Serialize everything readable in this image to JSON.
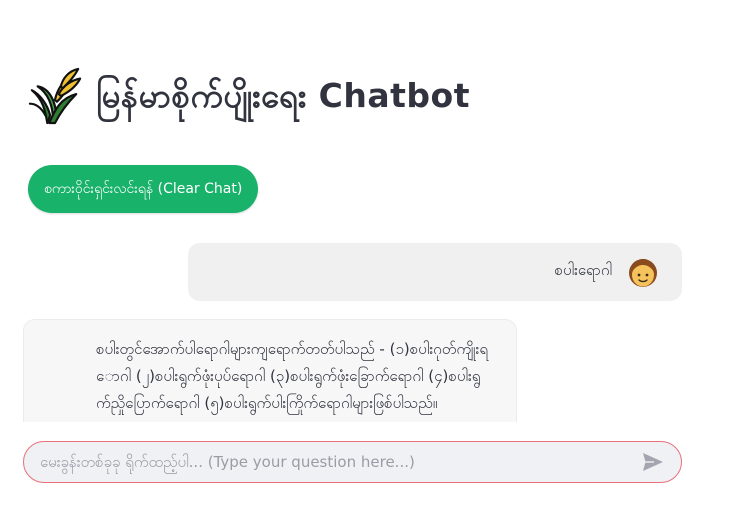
{
  "header": {
    "title": "မြန်မာစိုက်ပျိုးရေး Chatbot",
    "logo_icon": "rice-plant-icon"
  },
  "toolbar": {
    "clear_label": "စကားဝိုင်းရှင်းလင်းရန် (Clear Chat)"
  },
  "chat": {
    "messages": [
      {
        "role": "user",
        "text": "စပါးရောဂါ",
        "avatar_icon": "user-avatar-icon"
      },
      {
        "role": "assistant",
        "text": "စပါးတွင်အောက်ပါရောဂါများကျရောက်တတ်ပါသည် - (၁)စပါးဂုတ်ကျိုးရောဂါ (၂)စပါးရွက်ဖုံးပုပ်ရောဂါ (၃)စပါးရွက်ဖုံးခြောက်ရောဂါ (၄)စပါးရွက်ညှိုပြောက်ရောဂါ (၅)စပါးရွက်ပါးကြိုက်ရောဂါများဖြစ်ပါသည်။"
      }
    ]
  },
  "input": {
    "placeholder": "မေးခွန်းတစ်ခုခု ရိုက်ထည့်ပါ... (Type your question here...)",
    "value": "",
    "send_icon": "send-arrow-icon"
  },
  "colors": {
    "accent_green": "#19b26a",
    "input_border": "#e8707a",
    "text": "#31333f",
    "bubble_bg": "#f0f0f0"
  }
}
